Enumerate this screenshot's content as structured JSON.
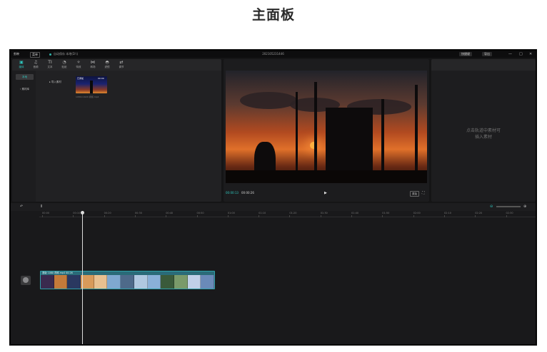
{
  "page_heading": "主面板",
  "app": {
    "titlebar": {
      "logo": "剪映",
      "menu": "菜单",
      "autosave": "自动保存 本地(D:\\)",
      "title": "202105231446",
      "shortcut_button": "快捷键",
      "export_button": "导出",
      "window_controls": [
        "—",
        "□",
        "✕"
      ]
    },
    "media_toolbar": [
      {
        "icon": "media-icon",
        "glyph": "▣",
        "label": "媒体"
      },
      {
        "icon": "audio-icon",
        "glyph": "♫",
        "label": "音频"
      },
      {
        "icon": "text-icon",
        "glyph": "TI",
        "label": "文本"
      },
      {
        "icon": "sticker-icon",
        "glyph": "◔",
        "label": "贴纸"
      },
      {
        "icon": "effects-icon",
        "glyph": "✧",
        "label": "特效"
      },
      {
        "icon": "transition-icon",
        "glyph": "⋈",
        "label": "转场"
      },
      {
        "icon": "filter-icon",
        "glyph": "◓",
        "label": "滤镜"
      },
      {
        "icon": "adjust-icon",
        "glyph": "⇄",
        "label": "调节"
      }
    ],
    "sidebar": [
      {
        "label": "本地"
      },
      {
        "label": "› 素材库"
      }
    ],
    "import_label": "▸  导入素材",
    "thumbnail": {
      "badge": "已添加",
      "duration": "00:09",
      "caption": "1080×1920 视频.mp4"
    },
    "player": {
      "current_time": "00:00:13",
      "total_time": "00:00:26",
      "play_glyph": "▶",
      "ratio_button": "原始",
      "fullscreen_glyph": "⛶"
    },
    "properties": {
      "empty_message_line1": "点击轨道中素材可",
      "empty_message_line2": "插入素材"
    },
    "timeline": {
      "undo_glyph": "↶",
      "split_glyph": "Ⅱ",
      "zoom_out_glyph": "⊖",
      "zoom_in_glyph": "⊕",
      "ruler_ticks": [
        "00:00",
        "00:10",
        "00:20",
        "00:30",
        "00:40",
        "00:50",
        "01:00",
        "01:10",
        "01:20",
        "01:30",
        "01:40",
        "01:50",
        "02:00",
        "02:10",
        "02:20",
        "02:30",
        "02:40"
      ],
      "clip_name": "竖版 1080 视频.mp4  00:26",
      "clip_frames": [
        "#3a2a4e",
        "#c47a3a",
        "#2a3860",
        "#d89a5a",
        "#e8c090",
        "#7fa8d0",
        "#4e6a8a",
        "#b0c8e0",
        "#8ab0d8",
        "#3a5a3a",
        "#7a9a6a",
        "#c0d0e8",
        "#6a8ab8"
      ]
    }
  },
  "colors": {
    "accent": "#2fc6bd",
    "background": "#151516",
    "panel": "#212123"
  }
}
